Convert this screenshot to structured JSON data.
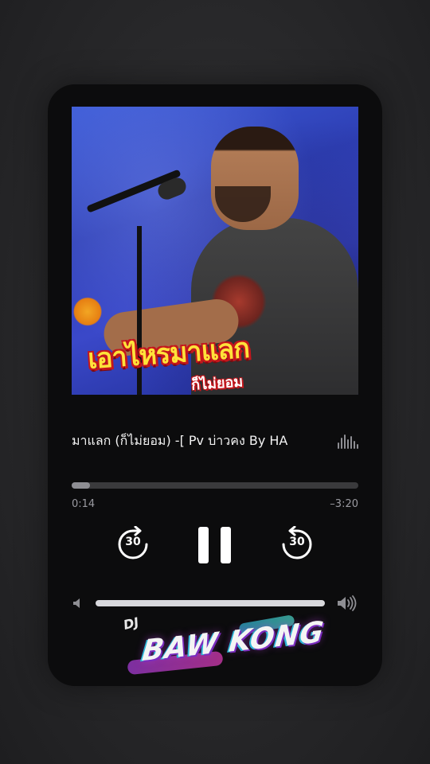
{
  "artwork": {
    "headline_text": "เอาไหรมาแลก",
    "sub_text": "ก็ไม่ยอม"
  },
  "now_playing": {
    "title": "มาแลก (ก็ไม่ยอม) -[ Pv บ่าวคง By HA"
  },
  "progress": {
    "elapsed": "0:14",
    "remaining": "–3:20",
    "fraction": 0.065
  },
  "controls": {
    "skip_back_seconds": "30",
    "skip_forward_seconds": "30",
    "state_icon": "pause-icon"
  },
  "volume": {
    "level": 1.0
  },
  "logo": {
    "prefix": "DJ",
    "name": "BAW KONG"
  },
  "colors": {
    "card_bg": "#0c0c0d",
    "progress_fill": "#8e8e93",
    "headline_yellow": "#ffe23a",
    "headline_red": "#c4161c"
  }
}
